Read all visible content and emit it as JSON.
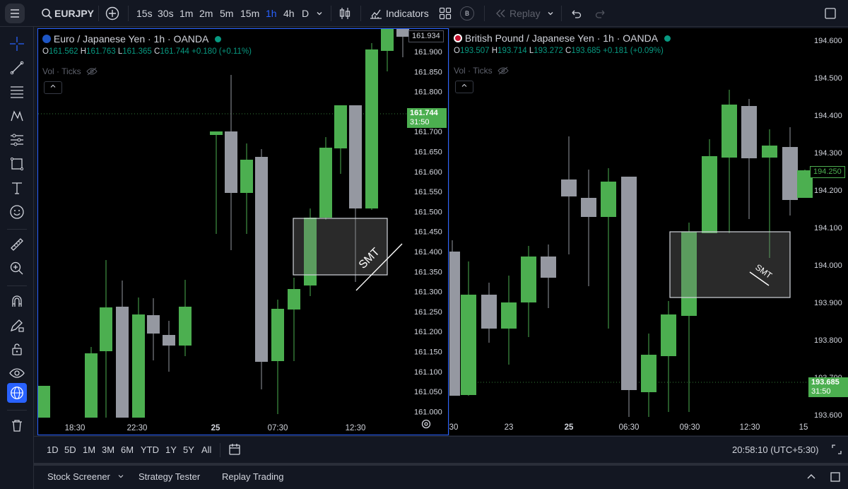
{
  "topbar": {
    "symbol": "EURJPY",
    "intervals": [
      "15s",
      "30s",
      "1m",
      "2m",
      "5m",
      "15m",
      "1h",
      "4h",
      "D"
    ],
    "active_interval": "1h",
    "indicators_label": "Indicators",
    "b_badge": "B",
    "replay_label": "Replay"
  },
  "left_pane": {
    "title": "Euro / Japanese Yen · 1h · OANDA",
    "ohlc": {
      "o_label": "O",
      "o": "161.562",
      "h_label": "H",
      "h": "161.763",
      "l_label": "L",
      "l": "161.365",
      "c_label": "C",
      "c": "161.744",
      "change": "+0.180 (+0.11%)"
    },
    "vol_label": "Vol · Ticks",
    "price_labels": [
      "161.900",
      "161.850",
      "161.800",
      "161.750",
      "161.700",
      "161.650",
      "161.600",
      "161.550",
      "161.500",
      "161.450",
      "161.400",
      "161.350",
      "161.300",
      "161.250",
      "161.200",
      "161.150",
      "161.100",
      "161.050",
      "161.000"
    ],
    "top_tag": "161.934",
    "last_price": "161.744",
    "countdown": "31:50",
    "time_labels": [
      "18:30",
      "22:30",
      "25",
      "07:30",
      "12:30"
    ],
    "annotation": "SMT"
  },
  "right_pane": {
    "title": "British Pound / Japanese Yen · 1h · OANDA",
    "ohlc": {
      "o_label": "O",
      "o": "193.507",
      "h_label": "H",
      "h": "193.714",
      "l_label": "L",
      "l": "193.272",
      "c_label": "C",
      "c": "193.685",
      "change": "+0.181 (+0.09%)"
    },
    "vol_label": "Vol · Ticks",
    "price_labels": [
      "194.600",
      "194.500",
      "194.400",
      "194.300",
      "194.200",
      "194.100",
      "194.000",
      "193.900",
      "193.800",
      "193.700",
      "193.600"
    ],
    "crosshair_price": "194.250",
    "last_price": "193.685",
    "countdown": "31:50",
    "time_labels": [
      "30",
      "23",
      "25",
      "06:30",
      "09:30",
      "12:30",
      "15"
    ],
    "annotation": "SMT"
  },
  "bottombar": {
    "ranges": [
      "1D",
      "5D",
      "1M",
      "3M",
      "6M",
      "YTD",
      "1Y",
      "5Y",
      "All"
    ],
    "clock": "20:58:10 (UTC+5:30)"
  },
  "panelbar": {
    "tabs": [
      "Stock Screener",
      "Strategy Tester",
      "Replay Trading"
    ]
  },
  "colors": {
    "up": "#4caf50",
    "down": "#9598a1",
    "bg": "#000000",
    "accent": "#2962ff",
    "change": "#089981"
  }
}
